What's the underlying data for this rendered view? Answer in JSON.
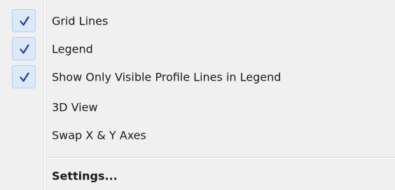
{
  "menu": {
    "items": [
      {
        "label": "Grid Lines",
        "checked": true
      },
      {
        "label": "Legend",
        "checked": true
      },
      {
        "label": "Show Only Visible Profile Lines in Legend",
        "checked": true
      },
      {
        "label": "3D View",
        "checked": false
      },
      {
        "label": "Swap X & Y Axes",
        "checked": false
      }
    ],
    "settings_label": "Settings..."
  },
  "colors": {
    "menu_background": "#f0f0f0",
    "check_highlight": "#dce9f9",
    "check_border": "#aecff7",
    "checkmark": "#1f3b9f"
  },
  "icons": {
    "checkmark": "checkmark-icon"
  }
}
